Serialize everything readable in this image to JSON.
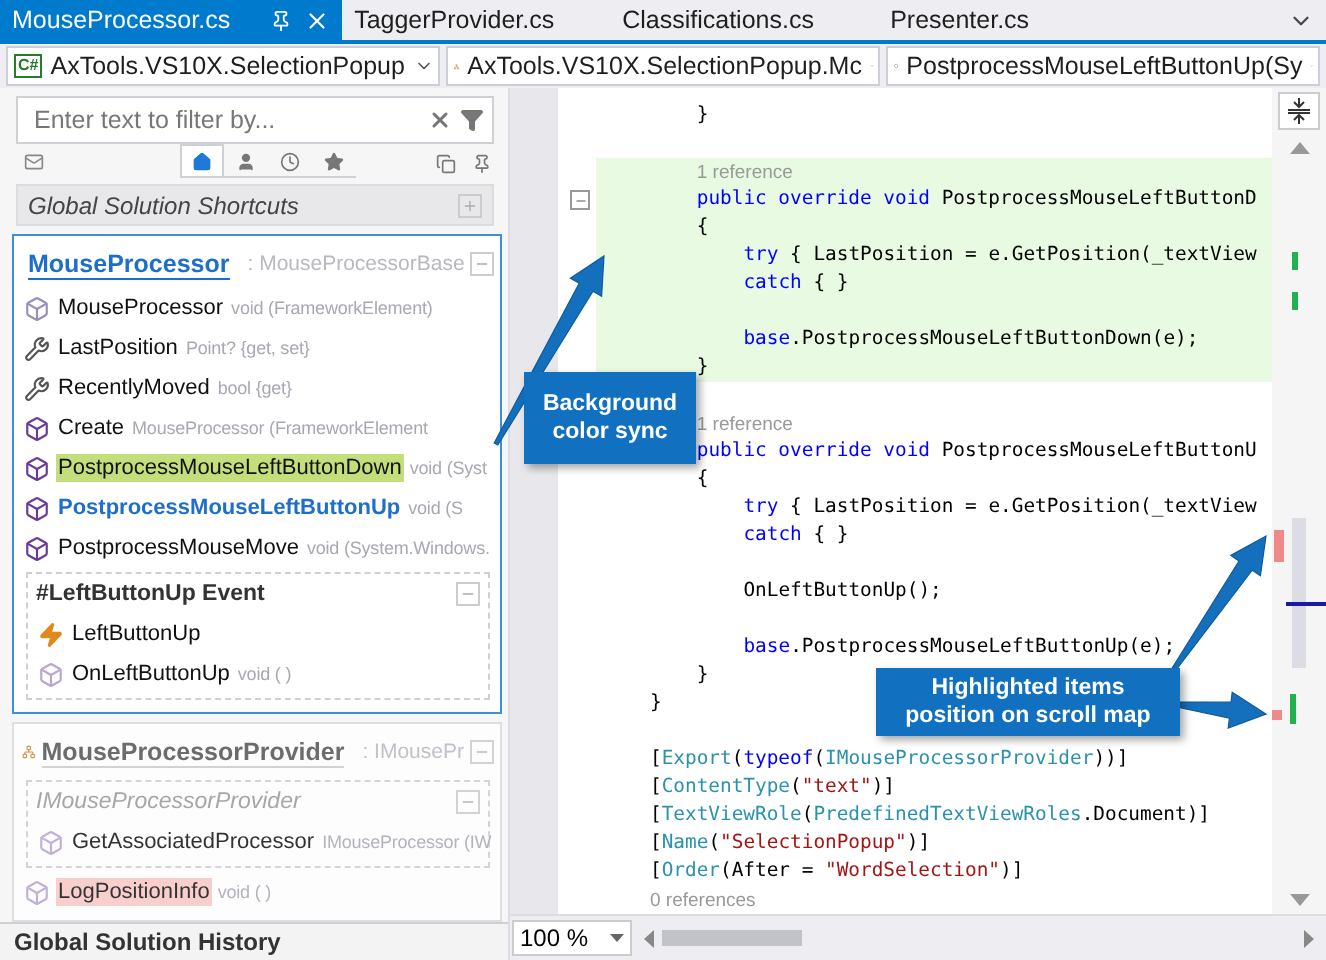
{
  "tabs": [
    {
      "label": "MouseProcessor.cs",
      "selected": true
    },
    {
      "label": "TaggerProvider.cs",
      "selected": false
    },
    {
      "label": "Classifications.cs",
      "selected": false
    },
    {
      "label": "Presenter.cs",
      "selected": false
    }
  ],
  "navigation": [
    {
      "kind": "project",
      "badge": "C#",
      "text": "AxTools.VS10X.SelectionPopup"
    },
    {
      "kind": "class",
      "text": "AxTools.VS10X.SelectionPopup.Mc"
    },
    {
      "kind": "member",
      "text": "PostprocessMouseLeftButtonUp(Sy"
    }
  ],
  "filter": {
    "placeholder": "Enter text to filter by..."
  },
  "view_tabs": [
    {
      "kind": "home",
      "selected": true
    },
    {
      "kind": "person",
      "selected": false
    },
    {
      "kind": "clock",
      "selected": false
    },
    {
      "kind": "star",
      "selected": false
    }
  ],
  "shortcuts_header": "Global Solution Shortcuts",
  "groups": [
    {
      "name": "MouseProcessor",
      "base": ": MouseProcessorBase",
      "selected": true,
      "items": [
        {
          "kind": "constructor",
          "name": "MouseProcessor",
          "detail": "void (FrameworkElement)",
          "highlighted": false,
          "current": false
        },
        {
          "kind": "property",
          "name": "LastPosition",
          "detail": "Point? {get, set}",
          "highlighted": false,
          "current": false
        },
        {
          "kind": "property",
          "name": "RecentlyMoved",
          "detail": "bool {get}",
          "highlighted": false,
          "current": false
        },
        {
          "kind": "static-method",
          "name": "Create",
          "detail": "MouseProcessor (FrameworkElement",
          "highlighted": false,
          "current": false
        },
        {
          "kind": "method",
          "name": "PostprocessMouseLeftButtonDown",
          "detail": "void (Syst",
          "highlighted": true,
          "color": "#c3de7a",
          "current": false
        },
        {
          "kind": "method",
          "name": "PostprocessMouseLeftButtonUp",
          "detail": "void (S",
          "highlighted": false,
          "current": true
        },
        {
          "kind": "method",
          "name": "PostprocessMouseMove",
          "detail": "void (System.Windows.",
          "highlighted": false,
          "current": false
        },
        {
          "kind": "region-section",
          "title": "#LeftButtonUp Event",
          "items": [
            {
              "kind": "event",
              "name": "LeftButtonUp",
              "highlighted": false,
              "current": false
            },
            {
              "kind": "private-method",
              "name": "OnLeftButtonUp",
              "detail": "void ( )",
              "highlighted": false,
              "current": false
            }
          ]
        }
      ]
    },
    {
      "name": "MouseProcessorProvider",
      "base": ": IMousePr",
      "selected": false,
      "items": [
        {
          "kind": "interface-section",
          "title": "IMouseProcessorProvider",
          "items": [
            {
              "kind": "interface-method",
              "name": "GetAssociatedProcessor",
              "detail": "IMouseProcessor (IW",
              "highlighted": false,
              "current": false
            }
          ]
        },
        {
          "kind": "private-method",
          "name": "LogPositionInfo",
          "detail": "void ( )",
          "highlighted": true,
          "color": "#f9c9c6",
          "current": false
        }
      ]
    }
  ],
  "history_header": "Global Solution History",
  "editor": {
    "zoom": "100 %",
    "lines": [
      {
        "kind": "code",
        "fold": false,
        "highlighted": false,
        "segments": [
          {
            "kind": "plain",
            "text": "    }"
          }
        ]
      },
      {
        "kind": "blank",
        "highlighted": false
      },
      {
        "kind": "codelens",
        "highlighted": true,
        "text": "    1 reference"
      },
      {
        "kind": "code",
        "fold": true,
        "highlighted": true,
        "segments": [
          {
            "kind": "keyword",
            "text": "    public override void"
          },
          {
            "kind": "plain",
            "text": " PostprocessMouseLeftButtonD"
          }
        ]
      },
      {
        "kind": "code",
        "fold": false,
        "highlighted": true,
        "segments": [
          {
            "kind": "plain",
            "text": "    {"
          }
        ]
      },
      {
        "kind": "code",
        "fold": false,
        "highlighted": true,
        "segments": [
          {
            "kind": "keyword",
            "text": "        try"
          },
          {
            "kind": "plain",
            "text": " { LastPosition = e.GetPosition(_textView"
          }
        ]
      },
      {
        "kind": "code",
        "fold": false,
        "highlighted": true,
        "segments": [
          {
            "kind": "keyword",
            "text": "        catch"
          },
          {
            "kind": "plain",
            "text": " { }"
          }
        ]
      },
      {
        "kind": "blank",
        "highlighted": true
      },
      {
        "kind": "code",
        "fold": false,
        "highlighted": true,
        "segments": [
          {
            "kind": "keyword",
            "text": "        base"
          },
          {
            "kind": "plain",
            "text": ".PostprocessMouseLeftButtonDown(e);"
          }
        ]
      },
      {
        "kind": "code",
        "fold": false,
        "highlighted": true,
        "segments": [
          {
            "kind": "plain",
            "text": "    }"
          }
        ]
      },
      {
        "kind": "blank",
        "highlighted": false
      },
      {
        "kind": "codelens",
        "highlighted": false,
        "text": "    1 reference"
      },
      {
        "kind": "code",
        "fold": false,
        "highlighted": false,
        "segments": [
          {
            "kind": "keyword",
            "text": "    public override void"
          },
          {
            "kind": "plain",
            "text": " PostprocessMouseLeftButtonU"
          }
        ]
      },
      {
        "kind": "code",
        "fold": false,
        "highlighted": false,
        "segments": [
          {
            "kind": "plain",
            "text": "    {"
          }
        ]
      },
      {
        "kind": "code",
        "fold": false,
        "highlighted": false,
        "segments": [
          {
            "kind": "keyword",
            "text": "        try"
          },
          {
            "kind": "plain",
            "text": " { LastPosition = e.GetPosition(_textView"
          }
        ]
      },
      {
        "kind": "code",
        "fold": false,
        "highlighted": false,
        "segments": [
          {
            "kind": "keyword",
            "text": "        catch"
          },
          {
            "kind": "plain",
            "text": " { }"
          }
        ]
      },
      {
        "kind": "blank",
        "highlighted": false
      },
      {
        "kind": "code",
        "fold": false,
        "highlighted": false,
        "segments": [
          {
            "kind": "plain",
            "text": "        OnLeftButtonUp();"
          }
        ]
      },
      {
        "kind": "blank",
        "highlighted": false
      },
      {
        "kind": "code",
        "fold": false,
        "highlighted": false,
        "segments": [
          {
            "kind": "keyword",
            "text": "        base"
          },
          {
            "kind": "plain",
            "text": ".PostprocessMouseLeftButtonUp(e);"
          }
        ]
      },
      {
        "kind": "code",
        "fold": false,
        "highlighted": false,
        "segments": [
          {
            "kind": "plain",
            "text": "    }"
          }
        ]
      },
      {
        "kind": "code",
        "fold": false,
        "highlighted": false,
        "segments": [
          {
            "kind": "plain",
            "text": "}"
          }
        ]
      },
      {
        "kind": "blank",
        "highlighted": false
      },
      {
        "kind": "code",
        "fold": false,
        "highlighted": false,
        "segments": [
          {
            "kind": "plain",
            "text": "["
          },
          {
            "kind": "type",
            "text": "Export"
          },
          {
            "kind": "plain",
            "text": "("
          },
          {
            "kind": "keyword",
            "text": "typeof"
          },
          {
            "kind": "plain",
            "text": "("
          },
          {
            "kind": "type",
            "text": "IMouseProcessorProvider"
          },
          {
            "kind": "plain",
            "text": "))]"
          }
        ]
      },
      {
        "kind": "code",
        "fold": false,
        "highlighted": false,
        "segments": [
          {
            "kind": "plain",
            "text": "["
          },
          {
            "kind": "type",
            "text": "ContentType"
          },
          {
            "kind": "plain",
            "text": "("
          },
          {
            "kind": "string",
            "text": "\"text\""
          },
          {
            "kind": "plain",
            "text": ")]"
          }
        ]
      },
      {
        "kind": "code",
        "fold": false,
        "highlighted": false,
        "segments": [
          {
            "kind": "plain",
            "text": "["
          },
          {
            "kind": "type",
            "text": "TextViewRole"
          },
          {
            "kind": "plain",
            "text": "("
          },
          {
            "kind": "type",
            "text": "PredefinedTextViewRoles"
          },
          {
            "kind": "plain",
            "text": ".Document)]"
          }
        ]
      },
      {
        "kind": "code",
        "fold": false,
        "highlighted": false,
        "segments": [
          {
            "kind": "plain",
            "text": "["
          },
          {
            "kind": "type",
            "text": "Name"
          },
          {
            "kind": "plain",
            "text": "("
          },
          {
            "kind": "string",
            "text": "\"SelectionPopup\""
          },
          {
            "kind": "plain",
            "text": ")]"
          }
        ]
      },
      {
        "kind": "code",
        "fold": false,
        "highlighted": false,
        "segments": [
          {
            "kind": "plain",
            "text": "["
          },
          {
            "kind": "type",
            "text": "Order"
          },
          {
            "kind": "plain",
            "text": "(After = "
          },
          {
            "kind": "string",
            "text": "\"WordSelection\""
          },
          {
            "kind": "plain",
            "text": ")]"
          }
        ]
      },
      {
        "kind": "codelens",
        "highlighted": false,
        "text": "0 references"
      }
    ]
  },
  "callouts": [
    {
      "lines": [
        "Background",
        "color sync"
      ]
    },
    {
      "lines": [
        "Highlighted items",
        "position on scroll map"
      ]
    }
  ]
}
